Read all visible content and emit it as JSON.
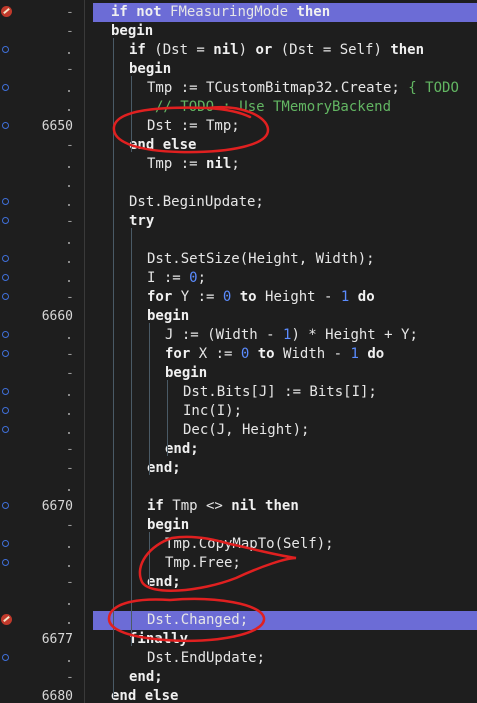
{
  "gutter": {
    "numbers": {
      "6": "6650",
      "16": "6660",
      "26": "6670",
      "33": "6677",
      "36": "6680"
    }
  },
  "code_lines": [
    [
      {
        "t": "if not ",
        "k": "kw"
      },
      {
        "t": "FMeasuringMode "
      },
      {
        "t": "then",
        "k": "kw"
      }
    ],
    [
      {
        "t": "begin",
        "k": "kw"
      }
    ],
    [
      {
        "t": "if",
        "k": "kw"
      },
      {
        "t": " (Dst = "
      },
      {
        "t": "nil",
        "k": "kw"
      },
      {
        "t": ") "
      },
      {
        "t": "or",
        "k": "kw"
      },
      {
        "t": " (Dst = Self) "
      },
      {
        "t": "then",
        "k": "kw"
      }
    ],
    [
      {
        "t": "begin",
        "k": "kw"
      }
    ],
    [
      {
        "t": "Tmp := TCustomBitmap32.Create; "
      },
      {
        "t": "{ TODO",
        "k": "cm"
      }
    ],
    [
      {
        "t": "// TODO : Use TMemoryBackend",
        "k": "cm"
      }
    ],
    [
      {
        "t": "Dst := Tmp;"
      }
    ],
    [
      {
        "t": "end else",
        "k": "kw"
      }
    ],
    [
      {
        "t": "Tmp := "
      },
      {
        "t": "nil",
        "k": "kw"
      },
      {
        "t": ";"
      }
    ],
    [],
    [
      {
        "t": "Dst.BeginUpdate;"
      }
    ],
    [
      {
        "t": "try",
        "k": "kw"
      }
    ],
    [],
    [
      {
        "t": "Dst.SetSize(Height, Width);"
      }
    ],
    [
      {
        "t": "I := "
      },
      {
        "t": "0",
        "k": "num"
      },
      {
        "t": ";"
      }
    ],
    [
      {
        "t": "for",
        "k": "kw"
      },
      {
        "t": " Y := "
      },
      {
        "t": "0",
        "k": "num"
      },
      {
        "t": " "
      },
      {
        "t": "to",
        "k": "kw"
      },
      {
        "t": " Height - "
      },
      {
        "t": "1",
        "k": "num"
      },
      {
        "t": " "
      },
      {
        "t": "do",
        "k": "kw"
      }
    ],
    [
      {
        "t": "begin",
        "k": "kw"
      }
    ],
    [
      {
        "t": "J := (Width - "
      },
      {
        "t": "1",
        "k": "num"
      },
      {
        "t": ") * Height + Y;"
      }
    ],
    [
      {
        "t": "for",
        "k": "kw"
      },
      {
        "t": " X := "
      },
      {
        "t": "0",
        "k": "num"
      },
      {
        "t": " "
      },
      {
        "t": "to",
        "k": "kw"
      },
      {
        "t": " Width - "
      },
      {
        "t": "1",
        "k": "num"
      },
      {
        "t": " "
      },
      {
        "t": "do",
        "k": "kw"
      }
    ],
    [
      {
        "t": "begin",
        "k": "kw"
      }
    ],
    [
      {
        "t": "Dst.Bits[J] := Bits[I];"
      }
    ],
    [
      {
        "t": "Inc(I);"
      }
    ],
    [
      {
        "t": "Dec(J, Height);"
      }
    ],
    [
      {
        "t": "end;",
        "k": "kw"
      }
    ],
    [
      {
        "t": "end;",
        "k": "kw"
      }
    ],
    [],
    [
      {
        "t": "if",
        "k": "kw"
      },
      {
        "t": " Tmp <> "
      },
      {
        "t": "nil",
        "k": "kw"
      },
      {
        "t": " "
      },
      {
        "t": "then",
        "k": "kw"
      }
    ],
    [
      {
        "t": "begin",
        "k": "kw"
      }
    ],
    [
      {
        "t": "Tmp.CopyMapTo(Self);"
      }
    ],
    [
      {
        "t": "Tmp.Free;"
      }
    ],
    [
      {
        "t": "end;",
        "k": "kw"
      }
    ],
    [],
    [
      {
        "t": "Dst.Changed;"
      }
    ],
    [
      {
        "t": "finally",
        "k": "kw"
      }
    ],
    [
      {
        "t": "Dst.EndUpdate;"
      }
    ],
    [
      {
        "t": "end;",
        "k": "kw"
      }
    ],
    [
      {
        "t": "end else",
        "k": "kw"
      }
    ]
  ]
}
